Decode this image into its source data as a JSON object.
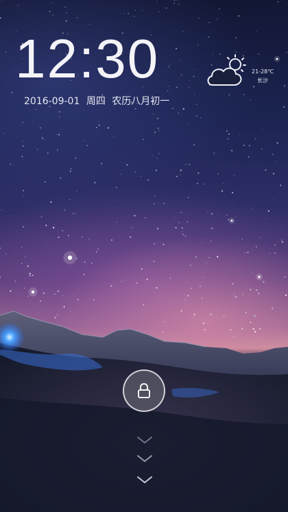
{
  "lockscreen": {
    "time": "12:30",
    "date": "2016-09-01",
    "weekday": "周四",
    "lunar_date": "农历八月初一",
    "weather": {
      "icon": "partly-cloudy-icon",
      "temperature": "21-28℃",
      "city": "长沙"
    },
    "unlock": {
      "icon": "lock-icon"
    },
    "swipe_hint": {
      "icon": "chevron-down-icon"
    }
  }
}
